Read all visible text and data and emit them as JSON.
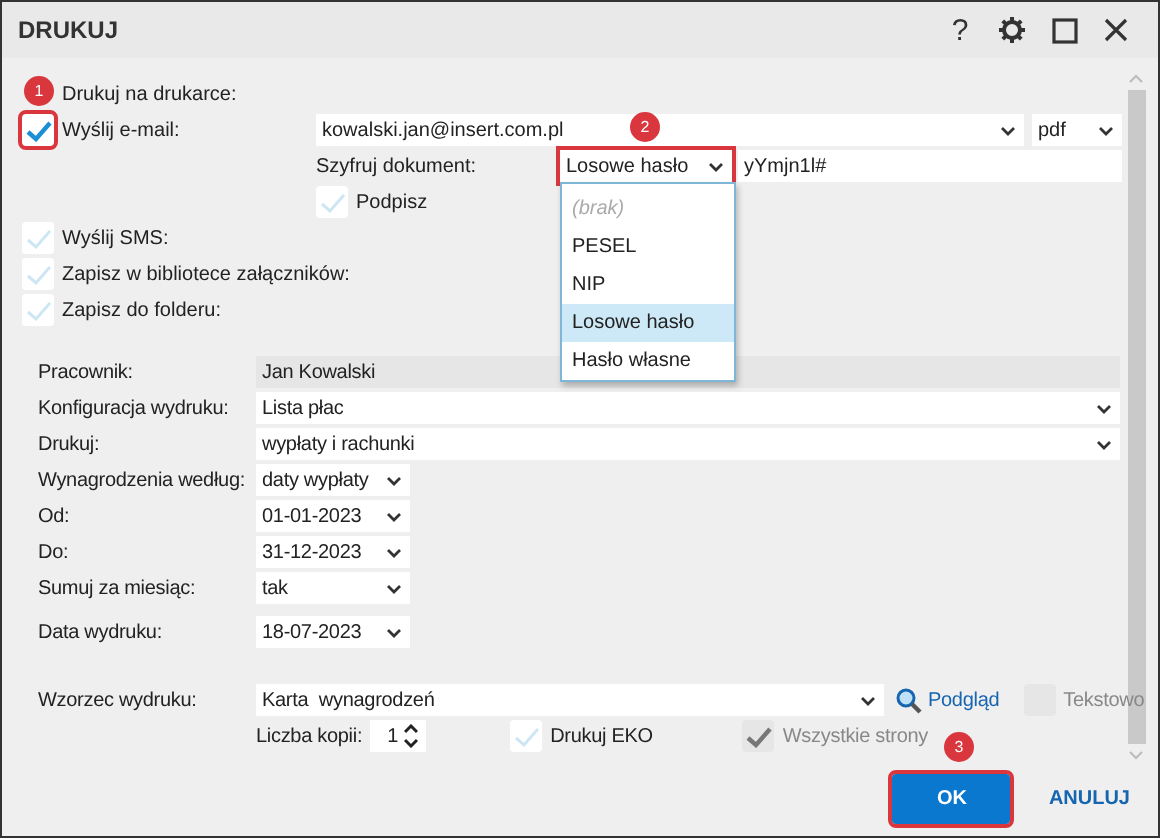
{
  "window": {
    "title": "DRUKUJ",
    "help": "?"
  },
  "printer": {
    "label": "Drukuj na drukarce:"
  },
  "email": {
    "label": "Wyślij e-mail:",
    "checked": true,
    "outlined": true,
    "address": "kowalski.jan@insert.com.pl",
    "format": "pdf",
    "encrypt": {
      "label": "Szyfruj dokument:",
      "value": "Losowe hasło",
      "outlined": true,
      "expanded": true,
      "password": "yYmjn1l#",
      "options": [
        {
          "label": "(brak)",
          "kind": "empty",
          "selected": false
        },
        {
          "label": "PESEL",
          "kind": "value",
          "selected": false
        },
        {
          "label": "NIP",
          "kind": "value",
          "selected": false
        },
        {
          "label": "Losowe hasło",
          "kind": "value",
          "selected": true
        },
        {
          "label": "Hasło własne",
          "kind": "value",
          "selected": false
        }
      ]
    },
    "sign": {
      "label": "Podpisz",
      "checked": false
    }
  },
  "outputs": [
    {
      "label": "Wyślij SMS:",
      "checked": false
    },
    {
      "label": "Zapisz w bibliotece załączników:",
      "checked": false
    },
    {
      "label": "Zapisz do folderu:",
      "checked": false
    }
  ],
  "fields": [
    {
      "label": "Pracownik:",
      "value": "Jan Kowalski",
      "kind": "readonly"
    },
    {
      "label": "Konfiguracja wydruku:",
      "value": "Lista płac",
      "kind": "wide"
    },
    {
      "label": "Drukuj:",
      "value": "wypłaty i rachunki",
      "kind": "wide"
    },
    {
      "label": "Wynagrodzenia według:",
      "value": "daty wypłaty",
      "kind": "short"
    },
    {
      "label": "Od:",
      "value": "01-01-2023",
      "kind": "short"
    },
    {
      "label": "Do:",
      "value": "31-12-2023",
      "kind": "short"
    },
    {
      "label": "Sumuj za miesiąc:",
      "value": "tak",
      "kind": "short"
    },
    {
      "label": "Data wydruku:",
      "value": "18-07-2023",
      "kind": "short"
    }
  ],
  "template": {
    "label": "Wzorzec wydruku:",
    "value": "Karta  wynagrodzeń",
    "preview": "Podgląd",
    "text_mode": {
      "label": "Tekstowo",
      "checked": false,
      "disabled": true
    }
  },
  "copies": {
    "label": "Liczba kopii:",
    "value": "1"
  },
  "eko": {
    "label": "Drukuj EKO",
    "checked": false
  },
  "all_pages": {
    "label": "Wszystkie strony",
    "checked": true,
    "disabled": true
  },
  "buttons": [
    {
      "label": "OK",
      "kind": "primary",
      "outlined": true
    },
    {
      "label": "ANULUJ",
      "kind": "link",
      "outlined": false
    }
  ],
  "callouts": [
    "1",
    "2",
    "3"
  ]
}
